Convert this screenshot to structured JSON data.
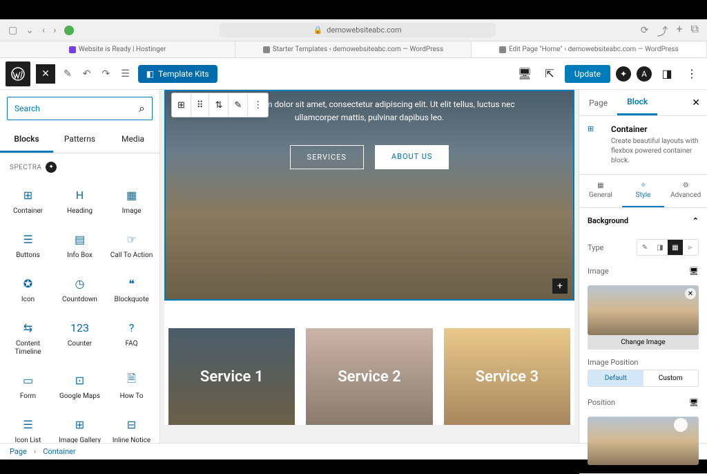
{
  "browser": {
    "url": "demowebsiteabc.com",
    "tabs": [
      {
        "label": "Website is Ready | Hostinger"
      },
      {
        "label": "Starter Templates ‹ demowebsiteabc.com — WordPress"
      },
      {
        "label": "Edit Page \"Home\" ‹ demowebsiteabc.com — WordPress"
      }
    ]
  },
  "wpBar": {
    "templateKits": "Template Kits",
    "updateLabel": "Update"
  },
  "leftPanel": {
    "searchPlaceholder": "Search",
    "tabs": {
      "blocks": "Blocks",
      "patterns": "Patterns",
      "media": "Media"
    },
    "sectionLabel": "SPECTRA",
    "blocks": [
      {
        "label": "Container",
        "icon": "container"
      },
      {
        "label": "Heading",
        "icon": "heading"
      },
      {
        "label": "Image",
        "icon": "image"
      },
      {
        "label": "Buttons",
        "icon": "buttons"
      },
      {
        "label": "Info Box",
        "icon": "infobox"
      },
      {
        "label": "Call To Action",
        "icon": "cta"
      },
      {
        "label": "Icon",
        "icon": "icon"
      },
      {
        "label": "Countdown",
        "icon": "countdown"
      },
      {
        "label": "Blockquote",
        "icon": "blockquote"
      },
      {
        "label": "Content Timeline",
        "icon": "timeline"
      },
      {
        "label": "Counter",
        "icon": "counter"
      },
      {
        "label": "FAQ",
        "icon": "faq"
      },
      {
        "label": "Form",
        "icon": "form"
      },
      {
        "label": "Google Maps",
        "icon": "map"
      },
      {
        "label": "How To",
        "icon": "howto"
      },
      {
        "label": "Icon List",
        "icon": "iconlist"
      },
      {
        "label": "Image Gallery",
        "icon": "gallery"
      },
      {
        "label": "Inline Notice",
        "icon": "notice"
      }
    ]
  },
  "canvas": {
    "heroText": "Lorem ipsum dolor sit amet, consectetur adipiscing elit. Ut elit tellus, luctus nec ullamcorper mattis, pulvinar dapibus leo.",
    "servicesBtn": "SERVICES",
    "aboutBtn": "ABOUT US",
    "services": [
      "Service 1",
      "Service 2",
      "Service 3"
    ]
  },
  "rightPanel": {
    "tabs": {
      "page": "Page",
      "block": "Block"
    },
    "blockName": "Container",
    "blockDesc": "Create beautiful layouts with flexbox powered container block.",
    "settingsTabs": {
      "general": "General",
      "style": "Style",
      "advanced": "Advanced"
    },
    "bgSection": "Background",
    "typeLabel": "Type",
    "imageLabel": "Image",
    "changeImage": "Change Image",
    "imgPosLabel": "Image Position",
    "posOptions": {
      "default": "Default",
      "custom": "Custom"
    },
    "positionLabel": "Position"
  },
  "breadcrumb": {
    "page": "Page",
    "container": "Container"
  }
}
